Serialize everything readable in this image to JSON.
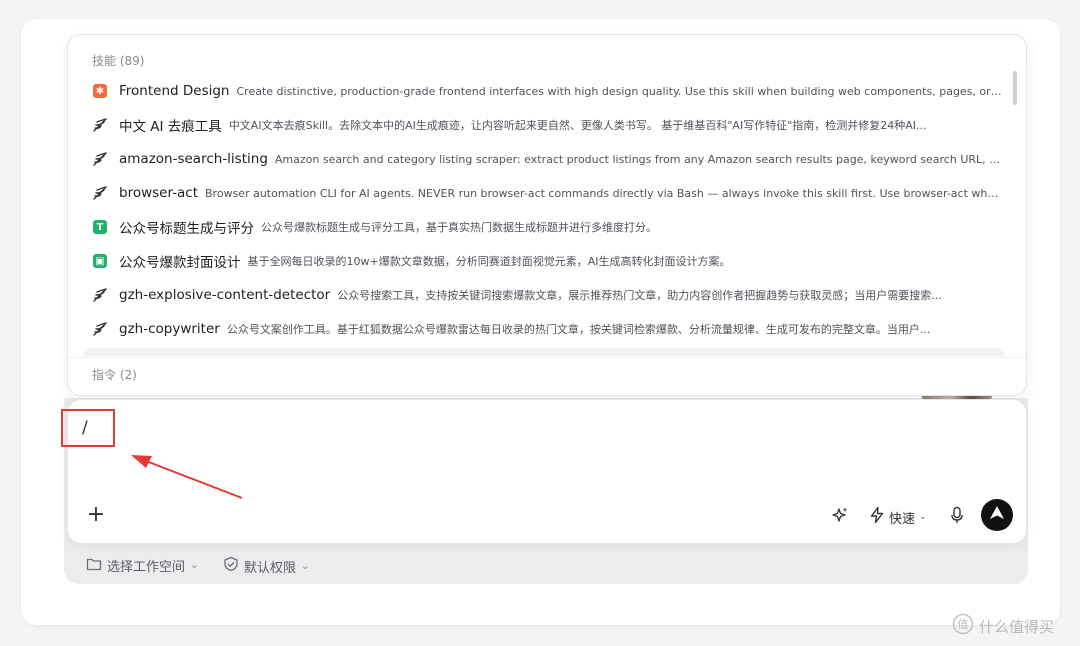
{
  "skills_header": "技能 (89)",
  "commands_header": "指令 (2)",
  "skills": [
    {
      "icon": "frontend-design-orange-icon",
      "name": "Frontend Design",
      "desc": "Create distinctive, production-grade frontend interfaces with high design quality. Use this skill when building web components, pages, or app..."
    },
    {
      "icon": "skill-feather-icon",
      "name": "中文 AI 去痕工具",
      "desc": "中文AI文本去痕Skill。去除文本中的AI生成痕迹，让内容听起来更自然、更像人类书写。 基于维基百科\"AI写作特征\"指南，检测并修复24种AI..."
    },
    {
      "icon": "skill-feather-icon",
      "name": "amazon-search-listing",
      "desc": "Amazon search and category listing scraper: extract product listings from any Amazon search results page, keyword search URL, or cate..."
    },
    {
      "icon": "skill-feather-icon",
      "name": "browser-act",
      "desc": "Browser automation CLI for AI agents. NEVER run browser-act commands directly via Bash — always invoke this skill first. Use browser-act when a ..."
    },
    {
      "icon": "title-green-icon",
      "name": "公众号标题生成与评分",
      "desc": "公众号爆款标题生成与评分工具，基于真实热门数据生成标题并进行多维度打分。"
    },
    {
      "icon": "cover-green-icon",
      "name": "公众号爆款封面设计",
      "desc": "基于全网每日收录的10w+爆款文章数据，分析同赛道封面视觉元素，AI生成高转化封面设计方案。"
    },
    {
      "icon": "skill-feather-icon",
      "name": "gzh-explosive-content-detector",
      "desc": "公众号搜索工具，支持按关键词搜索爆款文章，展示推荐热门文章，助力内容创作者把握趋势与获取灵感；当用户需要搜索..."
    },
    {
      "icon": "skill-feather-icon",
      "name": "gzh-copywriter",
      "desc": "公众号文案创作工具。基于红狐数据公众号爆款雷达每日收录的热门文章，按关键词检索爆款、分析流量规律、生成可发布的完整文章。当用户..."
    }
  ],
  "input": {
    "value": "/"
  },
  "toolbar": {
    "speed_label": "快速"
  },
  "footer": {
    "workspace_label": "选择工作空间",
    "permission_label": "默认权限"
  },
  "watermark": "什么值得买",
  "colors": {
    "accent_orange": "#f26b3a",
    "accent_green": "#21b26b",
    "annotation_red": "#e53935"
  }
}
